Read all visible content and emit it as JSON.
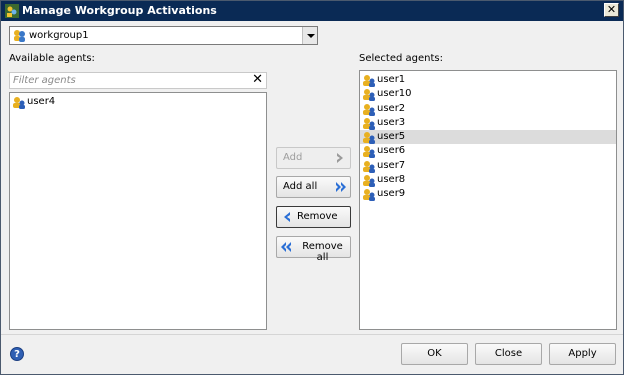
{
  "window": {
    "title": "Manage Workgroup Activations"
  },
  "workgroup": {
    "selected": "workgroup1"
  },
  "available": {
    "label": "Available agents:",
    "filter_placeholder": "Filter agents",
    "items": [
      "user4"
    ]
  },
  "selected": {
    "label": "Selected agents:",
    "items": [
      "user1",
      "user10",
      "user2",
      "user3",
      "user5",
      "user6",
      "user7",
      "user8",
      "user9"
    ],
    "highlighted": "user5"
  },
  "buttons": {
    "add": "Add",
    "add_all": "Add all",
    "remove": "Remove",
    "remove_all": "Remove all",
    "ok": "OK",
    "close": "Close",
    "apply": "Apply"
  },
  "icons": {
    "close": "close-icon",
    "help": "help-icon",
    "user": "user-icon",
    "group": "group-icon"
  },
  "colors": {
    "accent": "#2a6fd6",
    "selection": "#dcdcdc"
  }
}
